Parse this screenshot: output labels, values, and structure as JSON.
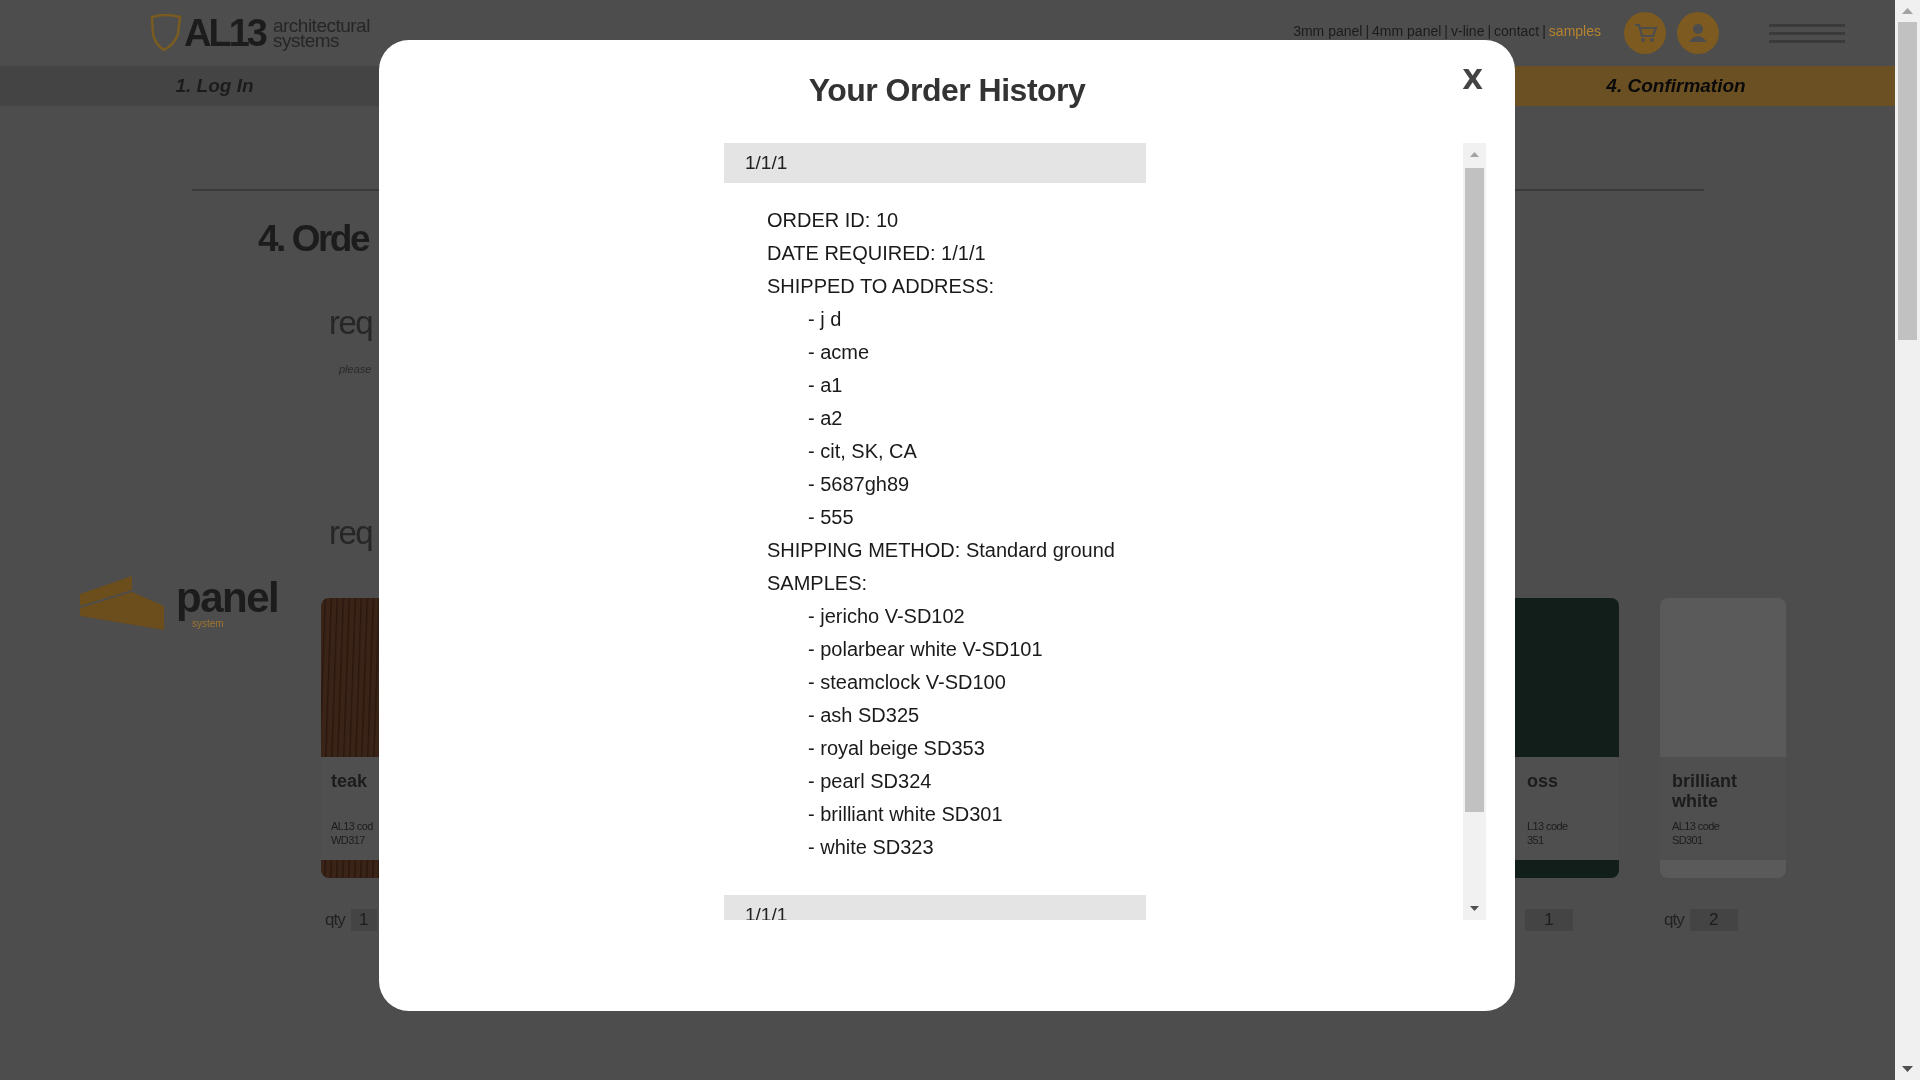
{
  "header": {
    "logo": {
      "mark": "AL13",
      "line_1": "architectural",
      "line_2": "systems"
    },
    "nav_items": [
      {
        "kind": "link",
        "label": "3mm panel",
        "selected": false
      },
      {
        "kind": "separator",
        "label": "|"
      },
      {
        "kind": "link",
        "label": "4mm panel",
        "selected": false
      },
      {
        "kind": "separator",
        "label": "|"
      },
      {
        "kind": "link",
        "label": "v-line",
        "selected": false
      },
      {
        "kind": "separator",
        "label": "|"
      },
      {
        "kind": "link",
        "label": "contact",
        "selected": false
      },
      {
        "kind": "separator",
        "label": "|"
      },
      {
        "kind": "link",
        "label": "samples",
        "selected": true
      }
    ]
  },
  "steps": [
    {
      "label": "1. Log In",
      "selected": false
    },
    {
      "label": "4. Confirmation",
      "selected": true
    }
  ],
  "page": {
    "heading": "4. Orde",
    "section_1": "req",
    "note": "please",
    "section_2": "req",
    "brand_logo": {
      "word": "panel",
      "sub": "system"
    },
    "samples_left": [
      {
        "name": "teak",
        "code_label": "AL13 cod",
        "code": "WD317",
        "qty_label": "qty",
        "qty": "1",
        "kind": "woodgrain",
        "color": "#3a2317"
      }
    ],
    "samples_right": [
      {
        "name": "oss",
        "code_label": "L13 code",
        "code": "351",
        "qty": "1",
        "kind": "solid",
        "color": "#121e1a"
      },
      {
        "name": "brilliant white",
        "code_label": "AL13 code",
        "code": "SD301",
        "qty_label": "qty",
        "qty": "2",
        "kind": "solid",
        "color": "#5a5a5a"
      }
    ]
  },
  "modal": {
    "title": "Your Order History",
    "close": "X",
    "orders": [
      {
        "date": "1/1/1",
        "details": [
          {
            "text": "ORDER ID: 10"
          },
          {
            "text": "DATE REQUIRED: 1/1/1"
          },
          {
            "text": "SHIPPED TO ADDRESS:",
            "children": [
              {
                "text": "- j d"
              },
              {
                "text": "- acme"
              },
              {
                "text": "- a1"
              },
              {
                "text": "- a2"
              },
              {
                "text": "- cit, SK, CA"
              },
              {
                "text": "- 5687gh89"
              },
              {
                "text": "- 555"
              }
            ]
          },
          {
            "text": "SHIPPING METHOD: Standard ground"
          },
          {
            "text": "SAMPLES:",
            "children": [
              {
                "text": "- jericho V-SD102"
              },
              {
                "text": "- polarbear white V-SD101"
              },
              {
                "text": "- steamclock V-SD100"
              },
              {
                "text": "- ash SD325"
              },
              {
                "text": "- royal beige SD353"
              },
              {
                "text": "- pearl SD324"
              },
              {
                "text": "- brilliant white SD301"
              },
              {
                "text": "- white SD323"
              }
            ]
          }
        ]
      },
      {
        "date": "1/1/1"
      }
    ]
  }
}
